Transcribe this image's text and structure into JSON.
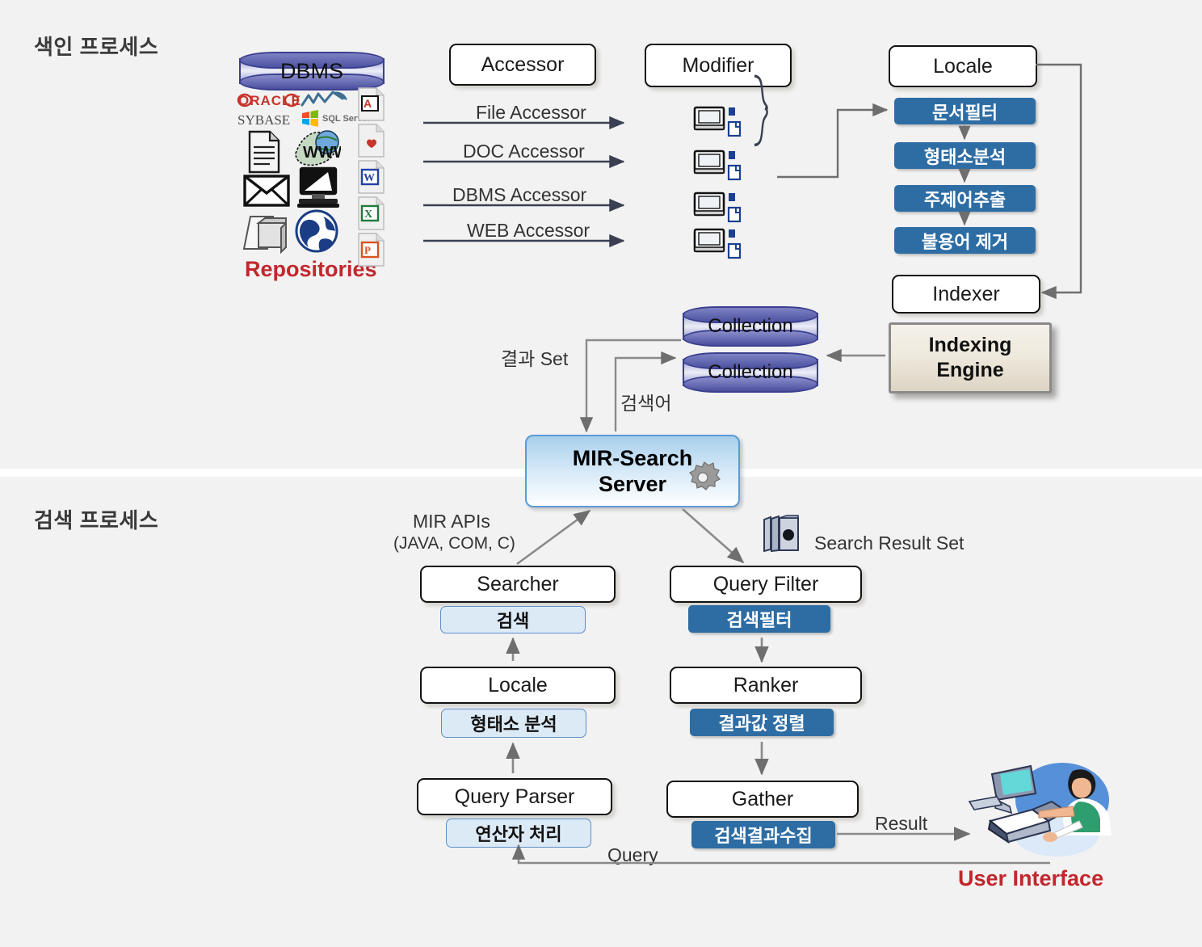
{
  "sections": {
    "indexing_title": "색인 프로세스",
    "search_title": "검색 프로세스"
  },
  "repositories": {
    "db_cylinder_label": "DBMS",
    "caption": "Repositories",
    "db_logos": [
      "ORACLE",
      "MySQL",
      "SYBASE",
      "MS SQL Server"
    ],
    "source_icons": [
      "document-icon",
      "www-globe-icon",
      "email-icon",
      "desktop-computer-icon",
      "folder-storage-icon",
      "internet-globe-icon"
    ],
    "file_type_icons": [
      "pdf-file-icon",
      "html-file-icon",
      "word-file-icon",
      "excel-file-icon",
      "powerpoint-file-icon"
    ]
  },
  "accessor": {
    "title": "Accessor",
    "flows": [
      "File Accessor",
      "DOC Accessor",
      "DBMS Accessor",
      "WEB Accessor"
    ]
  },
  "modifier": {
    "title": "Modifier",
    "item_count": 4,
    "item_icon": "monitor-with-document-icon"
  },
  "locale_index": {
    "title": "Locale",
    "steps": [
      "문서필터",
      "형태소분석",
      "주제어추출",
      "불용어 제거"
    ]
  },
  "indexer": {
    "title": "Indexer"
  },
  "indexing_engine": {
    "line1": "Indexing",
    "line2": "Engine"
  },
  "collections": [
    {
      "label": "Collection"
    },
    {
      "label": "Collection"
    }
  ],
  "server": {
    "line1": "MIR-Search",
    "line2": "Server",
    "icon": "gear-icon"
  },
  "edge_labels": {
    "result_set": "결과 Set",
    "query_term": "검색어",
    "mir_apis_line1": "MIR APIs",
    "mir_apis_line2": "(JAVA, COM, C)",
    "search_result_set": "Search Result Set",
    "result": "Result",
    "query": "Query"
  },
  "search_left_column": [
    {
      "node": "Searcher",
      "pill": "검색"
    },
    {
      "node": "Locale",
      "pill": "형태소 분석"
    },
    {
      "node": "Query Parser",
      "pill": "연산자 처리"
    }
  ],
  "search_right_column": [
    {
      "node": "Query Filter",
      "pill": "검색필터"
    },
    {
      "node": "Ranker",
      "pill": "결과값 정렬"
    },
    {
      "node": "Gather",
      "pill": "검색결과수집"
    }
  ],
  "user_interface": {
    "caption": "User Interface",
    "icon": "user-at-computers-icon"
  },
  "colors": {
    "background": "#f2f2f2",
    "pill_dark": "#2E6DA4",
    "pill_light": "#DCEAF6",
    "pill_light_border": "#5B8FC9",
    "accent_red": "#C1272D",
    "arrow_gray": "#808080",
    "node_border": "#111111",
    "cylinder_blue": "#4E53A2"
  }
}
